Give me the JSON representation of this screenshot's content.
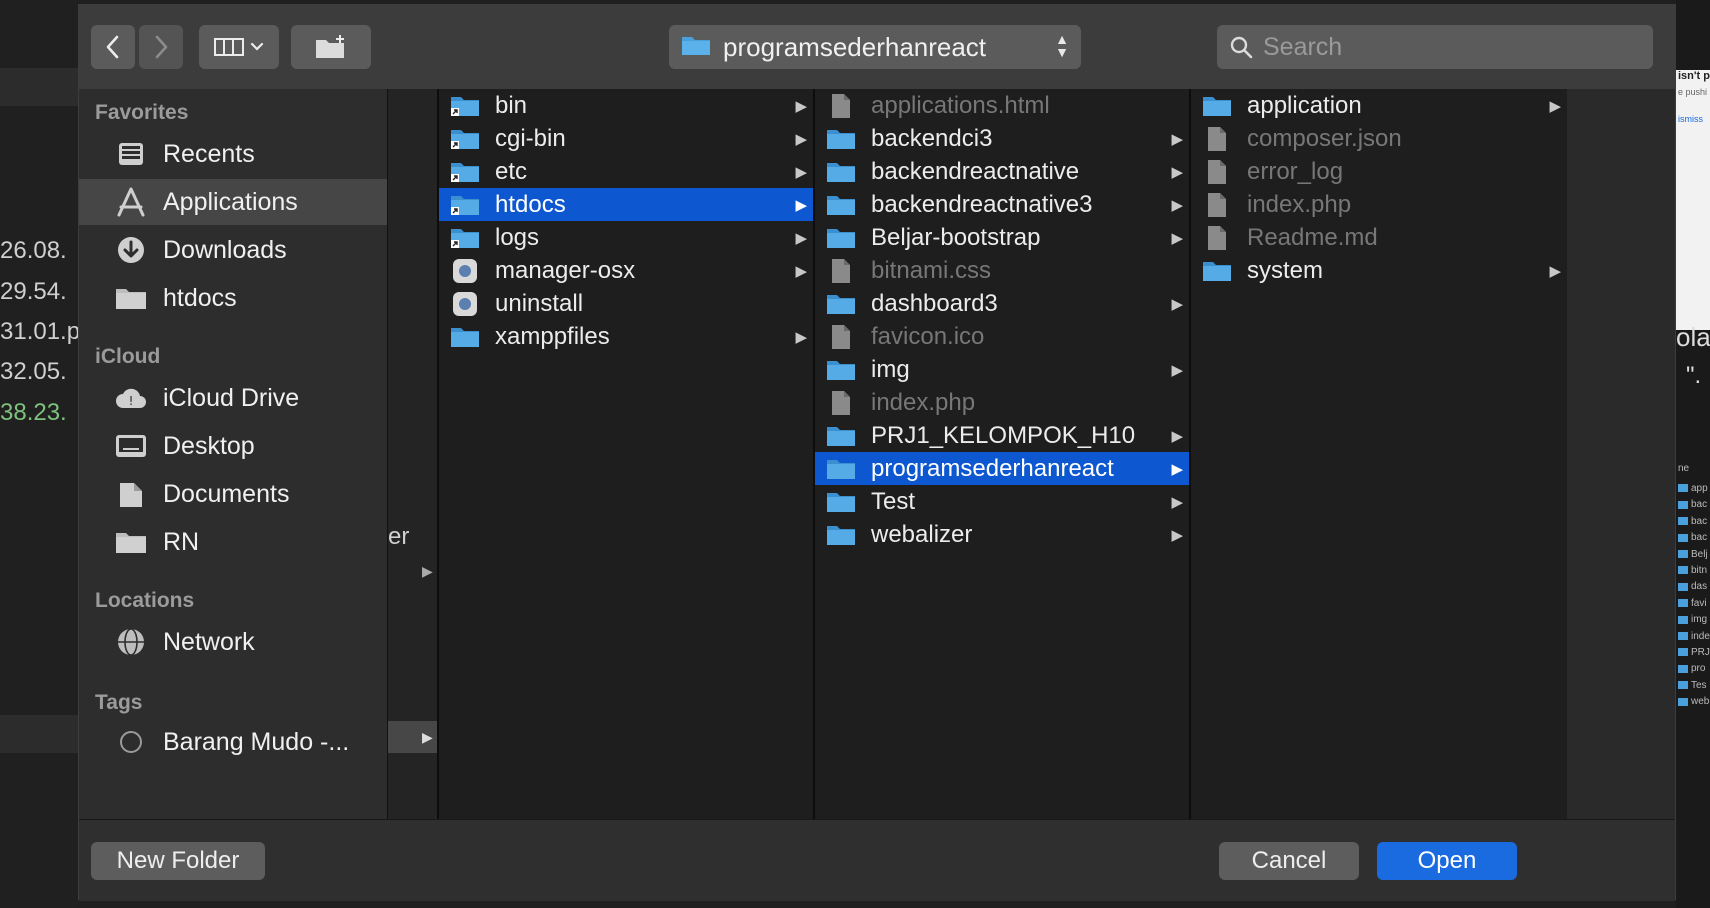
{
  "background": {
    "left_numbers": [
      "26.08.",
      "29.54.",
      "31.01.p",
      "32.05.",
      "38.23."
    ],
    "left_fragment": "er",
    "right_fragments": [
      "isn't p",
      "e pushi",
      "ismiss",
      "olat",
      "\".",
      "ne"
    ],
    "right_list": [
      "app",
      "bac",
      "bac",
      "bac",
      "Belj",
      "bitn",
      "das",
      "favi",
      "img",
      "inde",
      "PRJ",
      "pro",
      "Tes",
      "web"
    ]
  },
  "toolbar": {
    "back_icon": "chevron-left-icon",
    "forward_icon": "chevron-right-icon",
    "view_icon": "column-view-icon",
    "new_folder_icon": "new-folder-icon",
    "path": "programsederhanreact",
    "search_placeholder": "Search"
  },
  "sidebar": {
    "favorites_heading": "Favorites",
    "favorites": [
      {
        "label": "Recents",
        "icon": "clock-icon"
      },
      {
        "label": "Applications",
        "icon": "applications-icon",
        "selected": true
      },
      {
        "label": "Downloads",
        "icon": "download-icon"
      },
      {
        "label": "htdocs",
        "icon": "folder-icon"
      }
    ],
    "icloud_heading": "iCloud",
    "icloud": [
      {
        "label": "iCloud Drive",
        "icon": "cloud-icon"
      },
      {
        "label": "Desktop",
        "icon": "desktop-icon"
      },
      {
        "label": "Documents",
        "icon": "document-icon"
      },
      {
        "label": "RN",
        "icon": "folder-icon"
      }
    ],
    "locations_heading": "Locations",
    "locations": [
      {
        "label": "Network",
        "icon": "globe-icon"
      }
    ],
    "tags_heading": "Tags",
    "tags": [
      {
        "label": "Barang Mudo -...",
        "icon": "tag-circle-icon"
      }
    ]
  },
  "columns": {
    "col1": [
      {
        "label": "bin",
        "type": "folder-alias",
        "arrow": true
      },
      {
        "label": "cgi-bin",
        "type": "folder-alias",
        "arrow": true
      },
      {
        "label": "etc",
        "type": "folder-alias",
        "arrow": true
      },
      {
        "label": "htdocs",
        "type": "folder-alias",
        "arrow": true,
        "selected": true
      },
      {
        "label": "logs",
        "type": "folder-alias",
        "arrow": true
      },
      {
        "label": "manager-osx",
        "type": "app",
        "arrow": true
      },
      {
        "label": "uninstall",
        "type": "app",
        "arrow": false
      },
      {
        "label": "xamppfiles",
        "type": "folder",
        "arrow": true
      }
    ],
    "col2": [
      {
        "label": "applications.html",
        "type": "file",
        "dim": true,
        "arrow": false
      },
      {
        "label": "backendci3",
        "type": "folder",
        "arrow": true
      },
      {
        "label": "backendreactnative",
        "type": "folder",
        "arrow": true
      },
      {
        "label": "backendreactnative3",
        "type": "folder",
        "arrow": true
      },
      {
        "label": "Beljar-bootstrap",
        "type": "folder",
        "arrow": true
      },
      {
        "label": "bitnami.css",
        "type": "file",
        "dim": true,
        "arrow": false
      },
      {
        "label": "dashboard3",
        "type": "folder",
        "arrow": true
      },
      {
        "label": "favicon.ico",
        "type": "file",
        "dim": true,
        "arrow": false
      },
      {
        "label": "img",
        "type": "folder",
        "arrow": true
      },
      {
        "label": "index.php",
        "type": "file",
        "dim": true,
        "arrow": false
      },
      {
        "label": "PRJ1_KELOMPOK_H10",
        "type": "folder",
        "arrow": true
      },
      {
        "label": "programsederhanreact",
        "type": "folder",
        "arrow": true,
        "selected": true
      },
      {
        "label": "Test",
        "type": "folder",
        "arrow": true
      },
      {
        "label": "webalizer",
        "type": "folder",
        "arrow": true
      }
    ],
    "col3": [
      {
        "label": "application",
        "type": "folder",
        "arrow": true
      },
      {
        "label": "composer.json",
        "type": "file",
        "dim": true,
        "arrow": false
      },
      {
        "label": "error_log",
        "type": "file",
        "dim": true,
        "arrow": false
      },
      {
        "label": "index.php",
        "type": "file",
        "dim": true,
        "arrow": false
      },
      {
        "label": "Readme.md",
        "type": "file",
        "dim": true,
        "arrow": false
      },
      {
        "label": "system",
        "type": "folder",
        "arrow": true
      }
    ]
  },
  "footer": {
    "new_folder_label": "New Folder",
    "cancel_label": "Cancel",
    "open_label": "Open"
  },
  "colors": {
    "selection": "#0d58d0",
    "folder": "#4aa0dc",
    "primary_button": "#1a6ae0"
  }
}
